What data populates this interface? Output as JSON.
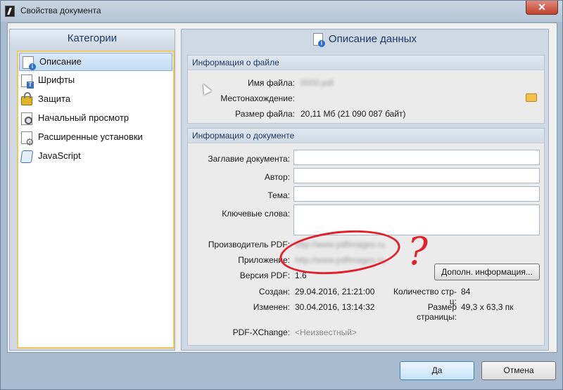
{
  "window": {
    "title": "Свойства документа",
    "close_symbol": "✕"
  },
  "categories": {
    "header": "Категории",
    "items": [
      {
        "label": "Описание",
        "icon": "document-info-icon",
        "selected": true
      },
      {
        "label": "Шрифты",
        "icon": "fonts-icon",
        "selected": false
      },
      {
        "label": "Защита",
        "icon": "lock-icon",
        "selected": false
      },
      {
        "label": "Начальный просмотр",
        "icon": "magnifier-icon",
        "selected": false
      },
      {
        "label": "Расширенные установки",
        "icon": "gear-icon",
        "selected": false
      },
      {
        "label": "JavaScript",
        "icon": "javascript-icon",
        "selected": false
      }
    ]
  },
  "main": {
    "header": "Описание данных",
    "file_info": {
      "title": "Информация о файле",
      "filename_label": "Имя файла:",
      "filename_value": "0000.pdf",
      "location_label": "Местонахождение:",
      "size_label": "Размер файла:",
      "size_value": "20,11 Мб (21 090 087 байт)"
    },
    "doc_info": {
      "title": "Информация о документе",
      "doc_title_label": "Заглавие документа:",
      "author_label": "Автор:",
      "subject_label": "Тема:",
      "keywords_label": "Ключевые слова:",
      "producer_label": "Производитель PDF:",
      "producer_value": "http://www.pdfimages.ru",
      "application_label": "Приложение:",
      "application_value": "http://www.pdfimages.ru",
      "pdf_version_label": "Версия PDF:",
      "pdf_version_value": "1.6",
      "created_label": "Создан:",
      "created_value": "29.04.2016, 21:21:00",
      "modified_label": "Изменен:",
      "modified_value": "30.04.2016, 13:14:32",
      "page_count_label": "Количество стр-ц:",
      "page_count_value": "84",
      "page_size_label": "Размер страницы:",
      "page_size_value": "49,3 x 63,3 пк",
      "more_button": "Дополн. информация...",
      "pdfxchange_label": "PDF-XChange:",
      "pdfxchange_value": "<Неизвестный>"
    },
    "annotation_question": "?"
  },
  "footer": {
    "ok": "Да",
    "cancel": "Отмена"
  },
  "colors": {
    "annotation": "#e0202a",
    "selection_border": "#f0c75a"
  }
}
